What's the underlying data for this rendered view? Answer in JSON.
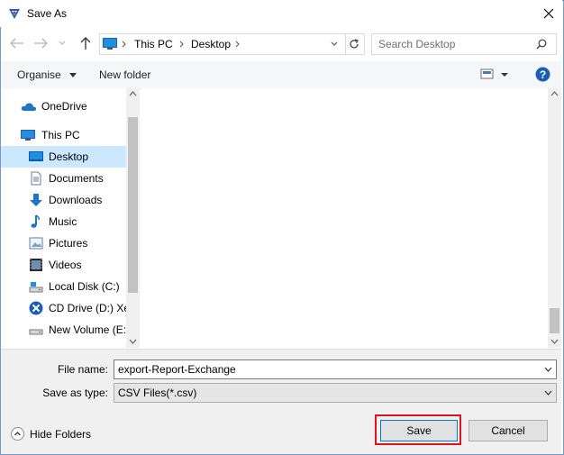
{
  "window": {
    "title": "Save As"
  },
  "address": {
    "path": [
      "This PC",
      "Desktop"
    ]
  },
  "search": {
    "placeholder": "Search Desktop"
  },
  "toolbar": {
    "organise_label": "Organise",
    "new_folder_label": "New folder"
  },
  "nav": {
    "items": [
      {
        "label": "OneDrive",
        "icon": "onedrive-icon",
        "selected": false
      },
      {
        "label": "This PC",
        "icon": "pc-icon",
        "selected": false
      },
      {
        "label": "Desktop",
        "icon": "desktop-icon",
        "selected": true
      },
      {
        "label": "Documents",
        "icon": "documents-icon",
        "selected": false
      },
      {
        "label": "Downloads",
        "icon": "downloads-icon",
        "selected": false
      },
      {
        "label": "Music",
        "icon": "music-icon",
        "selected": false
      },
      {
        "label": "Pictures",
        "icon": "pictures-icon",
        "selected": false
      },
      {
        "label": "Videos",
        "icon": "videos-icon",
        "selected": false
      },
      {
        "label": "Local Disk (C:)",
        "icon": "local-disk-icon",
        "selected": false
      },
      {
        "label": "CD Drive (D:) Xer",
        "icon": "cd-drive-icon",
        "selected": false
      },
      {
        "label": "New Volume (E:)",
        "icon": "drive-icon",
        "selected": false
      }
    ]
  },
  "form": {
    "filename_label": "File name:",
    "filename_value": "export-Report-Exchange",
    "savetype_label": "Save as type:",
    "savetype_value": "CSV Files(*.csv)"
  },
  "footer": {
    "hide_folders_label": "Hide Folders"
  },
  "buttons": {
    "save_label": "Save",
    "cancel_label": "Cancel"
  },
  "colors": {
    "accent": "#0078d7",
    "selection": "#cce8ff",
    "highlight": "#e0121a"
  }
}
